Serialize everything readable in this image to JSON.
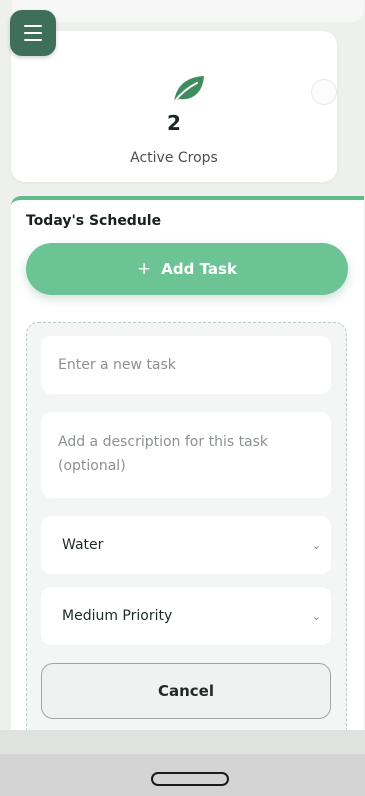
{
  "stats": {
    "active_crops_value": "2",
    "active_crops_label": "Active Crops"
  },
  "schedule": {
    "title": "Today's Schedule",
    "add_task_label": "Add Task",
    "form": {
      "task_placeholder": "Enter a new task",
      "description_placeholder": "Add a description for this task (optional)",
      "task_type_value": "Water",
      "priority_value": "Medium Priority",
      "cancel_label": "Cancel"
    }
  },
  "icons": {
    "menu": "hamburger-menu-icon",
    "leaf": "leaf-icon",
    "add": "plus-icon",
    "dropdown": "chevron-down-icon"
  },
  "colors": {
    "accent": "#6cc394",
    "menu_button": "#3f6f5b",
    "leaf": "#3f8d5e"
  }
}
